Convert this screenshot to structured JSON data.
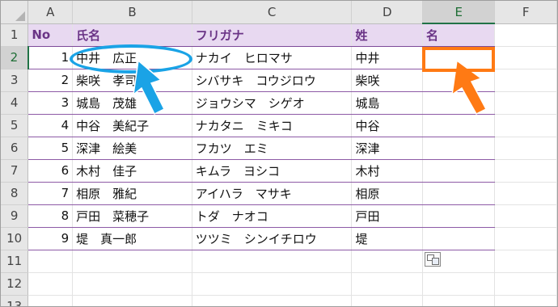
{
  "columns": [
    "A",
    "B",
    "C",
    "D",
    "E",
    "F"
  ],
  "selected_column": "E",
  "row_numbers": [
    "1",
    "2",
    "3",
    "4",
    "5",
    "6",
    "7",
    "8",
    "9",
    "10",
    "11",
    "12",
    "13"
  ],
  "selected_row": "2",
  "headers": {
    "no": "No",
    "name": "氏名",
    "furigana": "フリガナ",
    "sei": "姓",
    "mei": "名"
  },
  "rows": [
    {
      "no": "1",
      "name": "中井　広正",
      "furigana": "ナカイ　ヒロマサ",
      "sei": "中井",
      "mei": ""
    },
    {
      "no": "2",
      "name": "柴咲　孝司",
      "furigana": "シバサキ　コウジロウ",
      "sei": "柴咲",
      "mei": ""
    },
    {
      "no": "3",
      "name": "城島　茂雄",
      "furigana": "ジョウシマ　シゲオ",
      "sei": "城島",
      "mei": ""
    },
    {
      "no": "4",
      "name": "中谷　美紀子",
      "furigana": "ナカタニ　ミキコ",
      "sei": "中谷",
      "mei": ""
    },
    {
      "no": "5",
      "name": "深津　絵美",
      "furigana": "フカツ　エミ",
      "sei": "深津",
      "mei": ""
    },
    {
      "no": "6",
      "name": "木村　佳子",
      "furigana": "キムラ　ヨシコ",
      "sei": "木村",
      "mei": ""
    },
    {
      "no": "7",
      "name": "相原　雅紀",
      "furigana": "アイハラ　マサキ",
      "sei": "相原",
      "mei": ""
    },
    {
      "no": "8",
      "name": "戸田　菜穂子",
      "furigana": "トダ　ナオコ",
      "sei": "戸田",
      "mei": ""
    },
    {
      "no": "9",
      "name": "堤　真一郎",
      "furigana": "ツツミ　シンイチロウ",
      "sei": "堤",
      "mei": ""
    }
  ],
  "annotations": {
    "highlight_color": "#1aa3e6",
    "selection_color": "#ff7a14",
    "header_fill": "#e8d9f1",
    "header_text": "#6a3486"
  },
  "icons": {
    "corner": "select-all-triangle",
    "flash_fill": "flash-fill-options-icon"
  }
}
